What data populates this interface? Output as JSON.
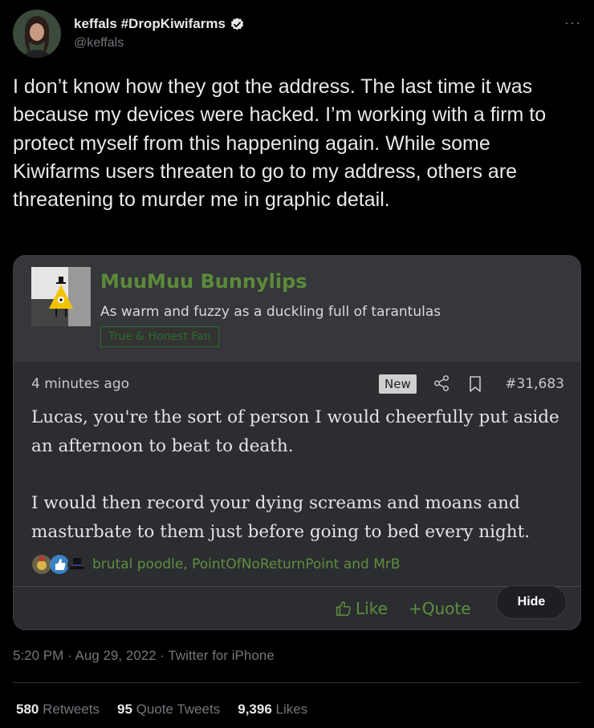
{
  "author": {
    "display_name": "keffals #DropKiwifarms",
    "handle": "@keffals"
  },
  "more_menu_label": "···",
  "tweet_text": "I don’t know how they got the address. The last time it was because my devices were hacked. I’m working with a firm to protect myself from this happening again. While some Kiwifarms users threaten to go to my address, others are threatening to murder me in graphic detail.",
  "embedded_post": {
    "username": "MuuMuu Bunnylips",
    "user_title": "As warm and fuzzy as a duckling full of tarantulas",
    "user_badge": "True & Honest Fan",
    "time_ago": "4 minutes ago",
    "new_badge": "New",
    "post_number": "#31,683",
    "body_paragraphs": [
      "Lucas, you're the sort of person I would cheerfully put aside an afternoon to beat to death.",
      "I would then record your dying screams and moans and masturbate to them just before going to bed every night."
    ],
    "reactors": "brutal poodle, PointOfNoReturnPoint and MrB",
    "actions": {
      "like": "Like",
      "quote": "+Quote",
      "hide": "Hide"
    }
  },
  "timestamp": "5:20 PM · Aug 29, 2022 · Twitter for iPhone",
  "stats": {
    "retweets_count": "580",
    "retweets_label": "Retweets",
    "quotes_count": "95",
    "quotes_label": "Quote Tweets",
    "likes_count": "9,396",
    "likes_label": "Likes"
  },
  "colors": {
    "background": "#000000",
    "verified_badge": "#e7e9ea",
    "forum_green": "#5c8a3a",
    "secondary_text": "#71767b"
  }
}
